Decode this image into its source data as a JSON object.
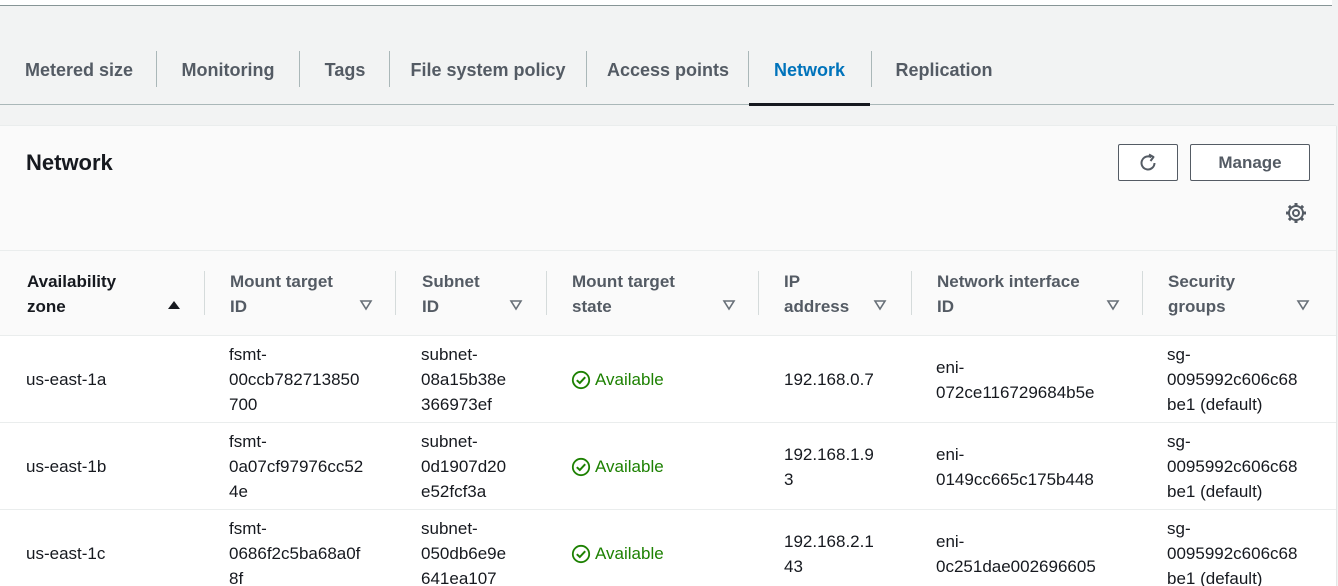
{
  "tabs": [
    {
      "label": "Metered size"
    },
    {
      "label": "Monitoring"
    },
    {
      "label": "Tags"
    },
    {
      "label": "File system policy"
    },
    {
      "label": "Access points"
    },
    {
      "label": "Network"
    },
    {
      "label": "Replication"
    }
  ],
  "active_tab": "Network",
  "panel": {
    "title": "Network",
    "manage_label": "Manage"
  },
  "table": {
    "columns": [
      {
        "line1": "Availability",
        "line2": "zone",
        "sort": "ascending"
      },
      {
        "line1": "Mount target",
        "line2": "ID",
        "sort": "none"
      },
      {
        "line1": "Subnet",
        "line2": "ID",
        "sort": "none"
      },
      {
        "line1": "Mount target",
        "line2": "state",
        "sort": "none"
      },
      {
        "line1": "IP",
        "line2": "address",
        "sort": "none"
      },
      {
        "line1": "Network interface",
        "line2": "ID",
        "sort": "none"
      },
      {
        "line1": "Security",
        "line2": "groups",
        "sort": "none"
      }
    ],
    "rows": [
      {
        "az": "us-east-1a",
        "mt": [
          "fsmt-",
          "00ccb782713850",
          "700"
        ],
        "subnet": [
          "subnet-",
          "08a15b38e",
          "366973ef"
        ],
        "state": "Available",
        "ip": [
          "192.168.0.7"
        ],
        "eni": [
          "eni-",
          "072ce116729684b5e"
        ],
        "sg": [
          "sg-",
          "0095992c606c68",
          "be1 (default)"
        ]
      },
      {
        "az": "us-east-1b",
        "mt": [
          "fsmt-",
          "0a07cf97976cc52",
          "4e"
        ],
        "subnet": [
          "subnet-",
          "0d1907d20",
          "e52fcf3a"
        ],
        "state": "Available",
        "ip": [
          "192.168.1.9",
          "3"
        ],
        "eni": [
          "eni-",
          "0149cc665c175b448"
        ],
        "sg": [
          "sg-",
          "0095992c606c68",
          "be1 (default)"
        ]
      },
      {
        "az": "us-east-1c",
        "mt": [
          "fsmt-",
          "0686f2c5ba68a0f",
          "8f"
        ],
        "subnet": [
          "subnet-",
          "050db6e9e",
          "641ea107"
        ],
        "state": "Available",
        "ip": [
          "192.168.2.1",
          "43"
        ],
        "eni": [
          "eni-",
          "0c251dae002696605"
        ],
        "sg": [
          "sg-",
          "0095992c606c68",
          "be1 (default)"
        ]
      }
    ]
  },
  "icons": {
    "refresh": "refresh-icon",
    "settings": "gear-icon",
    "sort_asc": "caret-up-filled-icon",
    "sort_none": "caret-down-outline-icon",
    "status_ok": "check-circle-icon"
  },
  "colors": {
    "active_tab": "#0073bb",
    "status_success": "#1d8102",
    "text": "#16191f",
    "muted": "#545b64"
  }
}
